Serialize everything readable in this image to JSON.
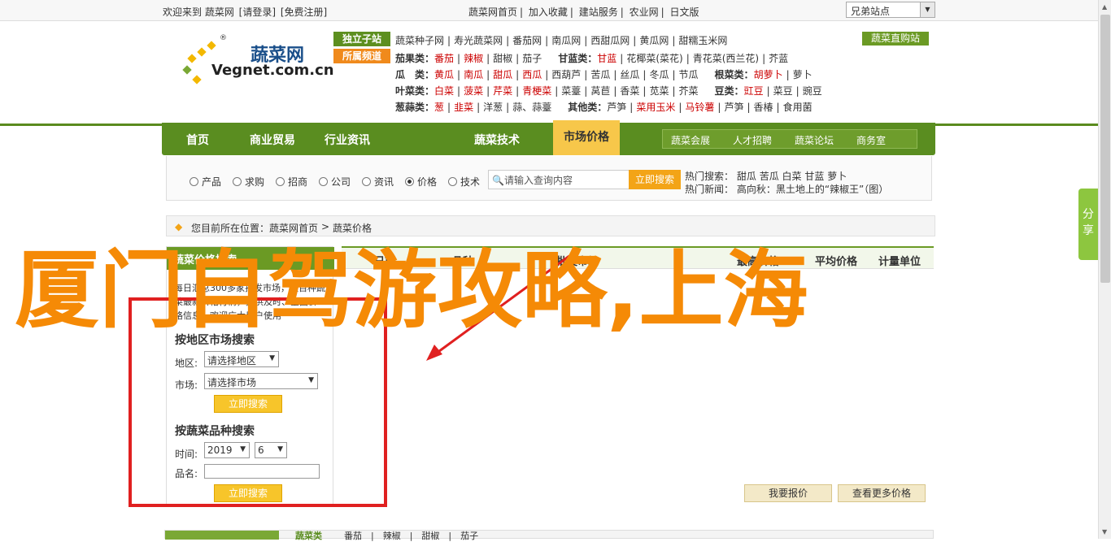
{
  "topbar": {
    "welcome": "欢迎来到 蔬菜网",
    "login": "[请登录]",
    "register": "[免费注册]",
    "links": [
      "蔬菜网首页",
      "加入收藏",
      "建站服务",
      "农业网",
      "日文版"
    ],
    "region_select": "兄弟站点"
  },
  "logo": {
    "cn": "蔬菜网",
    "en": "Vegnet.com.cn",
    "reg": "®"
  },
  "catbox": {
    "tag_sites": "独立子站",
    "tag_channels": "所属频道",
    "sites": [
      "蔬菜种子网",
      "寿光蔬菜网",
      "番茄网",
      "南瓜网",
      "西甜瓜网",
      "黄瓜网",
      "甜糯玉米网"
    ],
    "buy_label": "蔬菜直购站",
    "rows": [
      {
        "label": "茄果类：",
        "items": [
          [
            "番茄",
            true
          ],
          [
            "辣椒",
            true
          ],
          [
            "甜椒",
            false
          ],
          [
            "茄子",
            false
          ]
        ],
        "label2": "甘蓝类：",
        "items2": [
          [
            "甘蓝",
            true
          ],
          [
            "花椰菜(菜花)",
            false
          ],
          [
            "青花菜(西兰花)",
            false
          ],
          [
            "芥蓝",
            false
          ]
        ]
      },
      {
        "label": "瓜　类：",
        "items": [
          [
            "黄瓜",
            true
          ],
          [
            "南瓜",
            true
          ],
          [
            "甜瓜",
            true
          ],
          [
            "西瓜",
            true
          ],
          [
            "西葫芦",
            false
          ],
          [
            "苦瓜",
            false
          ],
          [
            "丝瓜",
            false
          ],
          [
            "冬瓜",
            false
          ],
          [
            "节瓜",
            false
          ]
        ],
        "label2": "根菜类：",
        "items2": [
          [
            "胡萝卜",
            true
          ],
          [
            "萝卜",
            false
          ]
        ]
      },
      {
        "label": "叶菜类：",
        "items": [
          [
            "白菜",
            true
          ],
          [
            "菠菜",
            true
          ],
          [
            "芹菜",
            true
          ],
          [
            "青梗菜",
            true
          ],
          [
            "菜薹",
            false
          ],
          [
            "莴苣",
            false
          ],
          [
            "香菜",
            false
          ],
          [
            "苋菜",
            false
          ],
          [
            "芥菜",
            false
          ]
        ],
        "label2": "豆类：",
        "items2": [
          [
            "豇豆",
            true
          ],
          [
            "菜豆",
            false
          ],
          [
            "豌豆",
            false
          ]
        ]
      },
      {
        "label": "葱蒜类：",
        "items": [
          [
            "葱",
            true
          ],
          [
            "韭菜",
            true
          ],
          [
            "洋葱",
            false
          ],
          [
            "蒜、蒜薹",
            false
          ]
        ],
        "label2": "其他类：",
        "items2": [
          [
            "芦笋",
            false
          ],
          [
            "菜用玉米",
            true
          ],
          [
            "马铃薯",
            true
          ],
          [
            "芦笋",
            false
          ],
          [
            "香椿",
            false
          ],
          [
            "食用菌",
            false
          ]
        ]
      }
    ]
  },
  "nav": {
    "items": [
      "首页",
      "商业贸易",
      "行业资讯",
      "市场价格",
      "蔬菜技术"
    ],
    "active": "市场价格",
    "sub": [
      "蔬菜会展",
      "人才招聘",
      "蔬菜论坛",
      "商务室"
    ]
  },
  "search": {
    "radios": [
      "产品",
      "求购",
      "招商",
      "公司",
      "资讯",
      "价格",
      "技术"
    ],
    "selected": "价格",
    "placeholder": "请输入查询内容",
    "button": "立即搜索",
    "hot_label": "热门搜索：",
    "hot_items": [
      "甜瓜",
      "苦瓜",
      "白菜",
      "甘蓝",
      "萝卜"
    ],
    "news_label": "热门新闻：",
    "news_text": "高向秋：黑土地上的“辣椒王”（图）"
  },
  "breadcrumb": {
    "label": "您目前所在位置：",
    "home": "蔬菜网首页",
    "sep": ">",
    "current": "蔬菜价格"
  },
  "sidebar": {
    "head": "蔬菜价格搜索",
    "intro": "每日汇总300多家批发市场，上百种蔬菜最新价格行情，提供及时、全面价格信息，欢迎广大用户使用",
    "region_title": "按地区市场搜索",
    "region_label": "地区:",
    "region_value": "请选择地区",
    "market_label": "市场:",
    "market_value": "请选择市场",
    "btn1": "立即搜索",
    "variety_title": "按蔬菜品种搜索",
    "time_label": "时间:",
    "year": "2019",
    "month": "6",
    "name_label": "品名:",
    "btn2": "立即搜索"
  },
  "table": {
    "headers": [
      "日期",
      "品种",
      "批发市场",
      "最高价格",
      "平均价格",
      "计量单位"
    ]
  },
  "table_buttons": {
    "quote": "我要报价",
    "more": "查看更多价格"
  },
  "bottom": {
    "title": "蔬菜类",
    "items": "番茄　|　辣椒　|　甜椒　|　茄子"
  },
  "overlay_text": "厦门自驾游攻略,上海",
  "sidetab": "分享",
  "colors": {
    "brand_green": "#5a8d20",
    "accent_orange": "#f58a06",
    "red_box": "#e02020"
  }
}
